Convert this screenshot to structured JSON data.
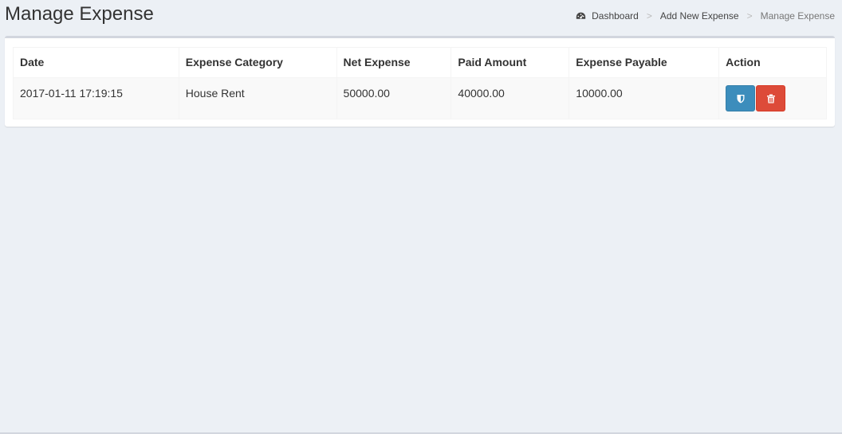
{
  "header": {
    "title": "Manage Expense"
  },
  "breadcrumb": {
    "items": [
      {
        "label": "Dashboard",
        "icon": "dashboard-icon"
      },
      {
        "label": "Add New Expense"
      },
      {
        "label": "Manage Expense",
        "active": true
      }
    ],
    "separator": ">"
  },
  "table": {
    "columns": [
      "Date",
      "Expense Category",
      "Net Expense",
      "Paid Amount",
      "Expense Payable",
      "Action"
    ],
    "rows": [
      {
        "date": "2017-01-11 17:19:15",
        "category": "House Rent",
        "net_expense": "50000.00",
        "paid_amount": "40000.00",
        "expense_payable": "10000.00",
        "actions": [
          {
            "icon": "shield-icon",
            "color": "#3c8dbc"
          },
          {
            "icon": "trash-icon",
            "color": "#dd4b39"
          }
        ]
      }
    ]
  },
  "colors": {
    "background": "#ecf0f5",
    "primary": "#3c8dbc",
    "danger": "#dd4b39",
    "box_border": "#d2d6de"
  }
}
